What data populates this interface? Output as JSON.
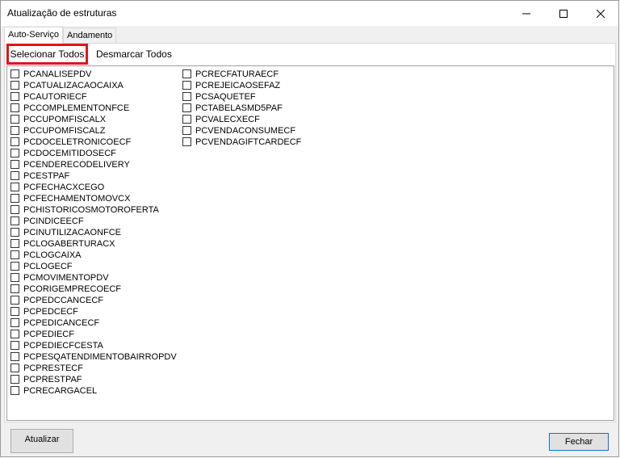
{
  "window": {
    "title": "Atualização de estruturas"
  },
  "tabs": [
    {
      "label": "Auto-Serviço"
    },
    {
      "label": "Andamento"
    }
  ],
  "toolbar": {
    "select_all": "Selecionar Todos",
    "deselect_all": "Desmarcar Todos"
  },
  "structures": {
    "col1": [
      "PCANALISEPDV",
      "PCATUALIZACAOCAIXA",
      "PCAUTORIECF",
      "PCCOMPLEMENTONFCE",
      "PCCUPOMFISCALX",
      "PCCUPOMFISCALZ",
      "PCDOCELETRONICOECF",
      "PCDOCEMITIDOSECF",
      "PCENDERECODELIVERY",
      "PCESTPAF",
      "PCFECHACXCEGO",
      "PCFECHAMENTOMOVCX",
      "PCHISTORICOSMOTOROFERTA",
      "PCINDICEECF",
      "PCINUTILIZACAONFCE",
      "PCLOGABERTURACX",
      "PCLOGCAIXA",
      "PCLOGECF",
      "PCMOVIMENTOPDV",
      "PCORIGEMPRECOECF",
      "PCPEDCCANCECF",
      "PCPEDCECF",
      "PCPEDICANCECF",
      "PCPEDIECF",
      "PCPEDIECFCESTA",
      "PCPESQATENDIMENTOBAIRROPDV",
      "PCPRESTECF",
      "PCPRESTPAF",
      "PCRECARGACEL"
    ],
    "col2": [
      "PCRECFATURAECF",
      "PCREJEICAOSEFAZ",
      "PCSAQUETEF",
      "PCTABELASMD5PAF",
      "PCVALECXECF",
      "PCVENDACONSUMECF",
      "PCVENDAGIFTCARDECF"
    ]
  },
  "footer": {
    "update": "Atualizar",
    "close": "Fechar"
  },
  "colors": {
    "highlight": "#e0141b",
    "accent": "#0078d7"
  }
}
